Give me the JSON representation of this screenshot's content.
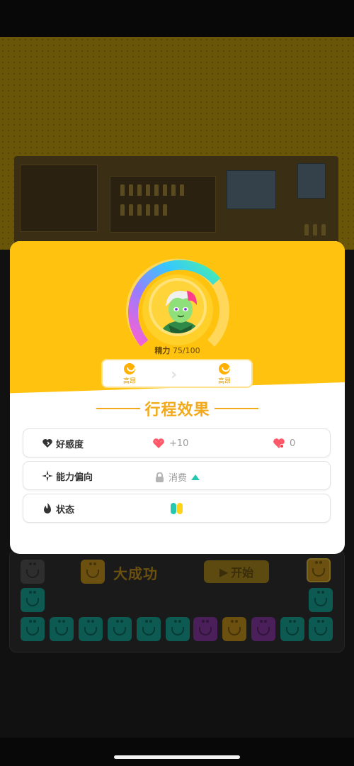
{
  "popup": {
    "energy_label": "精力",
    "energy_value": "75/100",
    "mood_from": "高昂",
    "mood_to": "高昂",
    "section_title": "行程效果",
    "rows": [
      {
        "label": "好感度",
        "value_1": "+10",
        "value_2": "0"
      },
      {
        "label": "能力偏向",
        "value_1": "消费"
      },
      {
        "label": "状态"
      }
    ]
  },
  "background": {
    "result_text": "大成功",
    "start_button": "开始"
  },
  "colors": {
    "card_top": "#ffc20e",
    "title_accent": "#f2a91a",
    "heart_red": "#ff3b4f",
    "teal": "#25c7b0",
    "yellow": "#ffd21a"
  }
}
